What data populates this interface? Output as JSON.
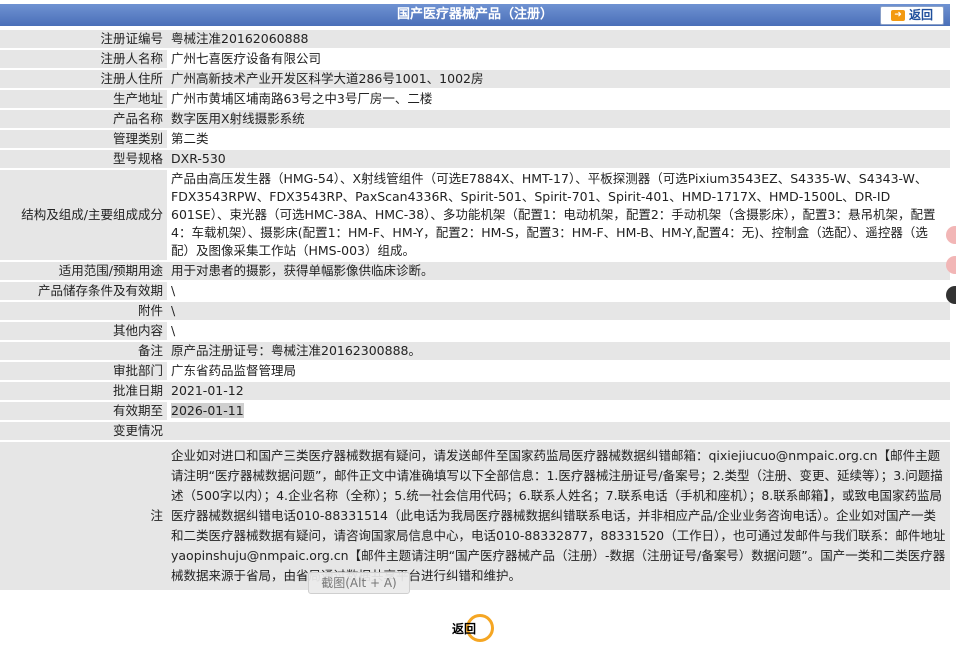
{
  "header": {
    "title": "国产医疗器械产品（注册）",
    "back_label": "返回"
  },
  "rows": [
    {
      "label": "注册证编号",
      "value": "粤械注准20162060888"
    },
    {
      "label": "注册人名称",
      "value": "广州七喜医疗设备有限公司"
    },
    {
      "label": "注册人住所",
      "value": "广州高新技术产业开发区科学大道286号1001、1002房"
    },
    {
      "label": "生产地址",
      "value": "广州市黄埔区埔南路63号之中3号厂房一、二楼"
    },
    {
      "label": "产品名称",
      "value": "数字医用X射线摄影系统"
    },
    {
      "label": "管理类别",
      "value": "第二类"
    },
    {
      "label": "型号规格",
      "value": "DXR-530"
    },
    {
      "label": "结构及组成/主要组成成分",
      "value": "产品由高压发生器（HMG-54）、X射线管组件（可选E7884X、HMT-17）、平板探测器（可选Pixium3543EZ、S4335-W、S4343-W、FDX3543RPW、FDX3543RP、PaxScan4336R、Spirit-501、Spirit-701、Spirit-401、HMD-1717X、HMD-1500L、DR-ID 601SE）、束光器（可选HMC-38A、HMC-38）、多功能机架（配置1：电动机架，配置2：手动机架（含摄影床），配置3：悬吊机架，配置4：车载机架）、摄影床(配置1：HM-F、HM-Y，配置2：HM-S，配置3：HM-F、HM-B、HM-Y,配置4：无)、控制盒（选配）、遥控器（选配）及图像采集工作站（HMS-003）组成。"
    },
    {
      "label": "适用范围/预期用途",
      "value": "用于对患者的摄影，获得单幅影像供临床诊断。"
    },
    {
      "label": "产品储存条件及有效期",
      "value": "\\"
    },
    {
      "label": "附件",
      "value": "\\"
    },
    {
      "label": "其他内容",
      "value": "\\"
    },
    {
      "label": "备注",
      "value": "原产品注册证号：粤械注准20162300888。"
    },
    {
      "label": "审批部门",
      "value": "广东省药品监督管理局"
    },
    {
      "label": "批准日期",
      "value": "2021-01-12"
    },
    {
      "label": "有效期至",
      "value": "2026-01-11"
    },
    {
      "label": "变更情况",
      "value": ""
    }
  ],
  "note": {
    "label": "注",
    "text": "企业如对进口和国产三类医疗器械数据有疑问，请发送邮件至国家药监局医疗器械数据纠错邮箱：qixiejiucuo@nmpaic.org.cn【邮件主题请注明“医疗器械数据问题”，邮件正文中请准确填写以下全部信息：1.医疗器械注册证号/备案号；2.类型（注册、变更、延续等）；3.问题描述（500字以内）；4.企业名称（全称）；5.统一社会信用代码；6.联系人姓名；7.联系电话（手机和座机）；8.联系邮箱】，或致电国家药监局医疗器械数据纠错电话010-88331514（此电话为我局医疗器械数据纠错联系电话，并非相应产品/企业业务咨询电话）。企业如对国产一类和二类医疗器械数据有疑问，请咨询国家局信息中心，电话010-88332877，88331520（工作日），也可通过发邮件与我们联系：邮件地址yaopinshuju@nmpaic.org.cn【邮件主题请注明“国产医疗器械产品（注册）-数据（注册证号/备案号）数据问题”。国产一类和二类医疗器械数据来源于省局，由省局通过数据共享平台进行纠错和维护。"
  },
  "tooltip": {
    "text": "截图(Alt + A)"
  },
  "footer": {
    "back_label": "返回"
  },
  "colors": {
    "header": "#5b82c8",
    "label_bg": "#e6e6e6",
    "back_ring": "#f5a623"
  }
}
